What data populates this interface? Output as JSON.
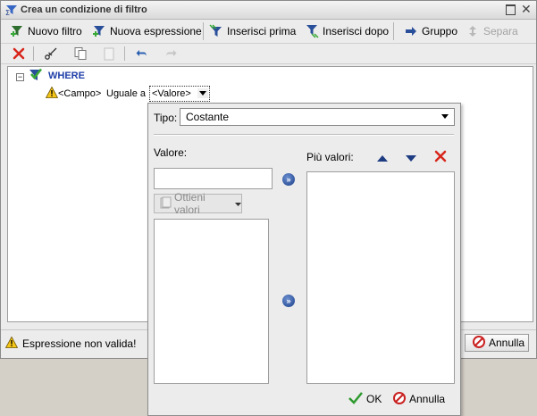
{
  "window": {
    "title": "Crea un condizione di filtro"
  },
  "toolbar1": {
    "new_filter": "Nuovo filtro",
    "new_expression": "Nuova espressione",
    "insert_before": "Inserisci prima",
    "insert_after": "Inserisci dopo",
    "group": "Gruppo",
    "separate": "Separa"
  },
  "tree": {
    "toggle": "−",
    "root": "WHERE",
    "condition": {
      "field": "<Campo>",
      "operator": "Uguale a",
      "value": "<Valore>"
    }
  },
  "status": {
    "message": "Espressione non valida!",
    "cancel": "Annulla"
  },
  "popup": {
    "type_label": "Tipo:",
    "type_value": "Costante",
    "value_label": "Valore:",
    "value_input": "",
    "get_values": "Ottieni valori",
    "multi_label": "Più valori:",
    "move_symbol": "»",
    "ok": "OK",
    "cancel": "Annulla"
  },
  "colors": {
    "accent_blue": "#1f3fa8",
    "delete_red": "#d8261c",
    "ok_green": "#2e9a2e"
  }
}
